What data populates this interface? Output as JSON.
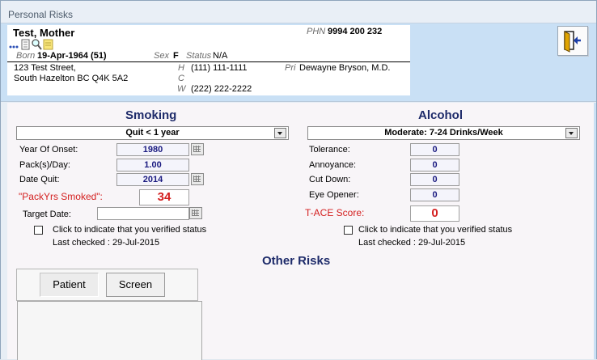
{
  "window": {
    "title": "Personal Risks"
  },
  "patient": {
    "name": "Test, Mother",
    "phn_label": "PHN",
    "phn": "9994 200 232",
    "born_label": "Born",
    "born": "19-Apr-1964 (51)",
    "sex_label": "Sex",
    "sex": "F",
    "status_label": "Status",
    "status": "N/A",
    "address_line1": "123 Test Street,",
    "address_line2": "South Hazelton BC  Q4K 5A2",
    "phone_h_label": "H",
    "phone_h": "(111) 111-1111",
    "phone_c_label": "C",
    "phone_w_label": "W",
    "phone_w": "(222) 222-2222",
    "pri_label": "Pri",
    "pri": "Dewayne Bryson, M.D."
  },
  "smoking": {
    "title": "Smoking",
    "status": "Quit < 1 year",
    "year_of_onset_label": "Year Of Onset:",
    "year_of_onset": "1980",
    "packs_label": "Pack(s)/Day:",
    "packs": "1.00",
    "date_quit_label": "Date Quit:",
    "date_quit": "2014",
    "packyrs_label": "\"PackYrs Smoked\":",
    "packyrs": "34",
    "target_date_label": "Target Date:",
    "target_date": "",
    "verify_label": "Click to indicate that you verified status",
    "last_checked": "Last checked : 29-Jul-2015"
  },
  "alcohol": {
    "title": "Alcohol",
    "status": "Moderate: 7-24 Drinks/Week",
    "tolerance_label": "Tolerance:",
    "tolerance": "0",
    "annoyance_label": "Annoyance:",
    "annoyance": "0",
    "cutdown_label": "Cut Down:",
    "cutdown": "0",
    "eyeopener_label": "Eye Opener:",
    "eyeopener": "0",
    "tace_label": "T-ACE Score:",
    "tace": "0",
    "verify_label": "Click to indicate that you verified status",
    "last_checked": "Last checked : 29-Jul-2015"
  },
  "other_risks": {
    "title": "Other Risks",
    "tabs": [
      {
        "label": "Patient"
      },
      {
        "label": "Screen"
      }
    ]
  },
  "icons": {
    "exit": "exit-door-icon",
    "more": "more-dots-icon",
    "document": "document-icon",
    "search": "magnifier-icon",
    "note": "sticky-note-icon"
  },
  "colors": {
    "header_bg": "#c9e0f5",
    "section_title": "#1e2b6a",
    "alert_red": "#d42020",
    "value_blue": "#1a1a80"
  }
}
